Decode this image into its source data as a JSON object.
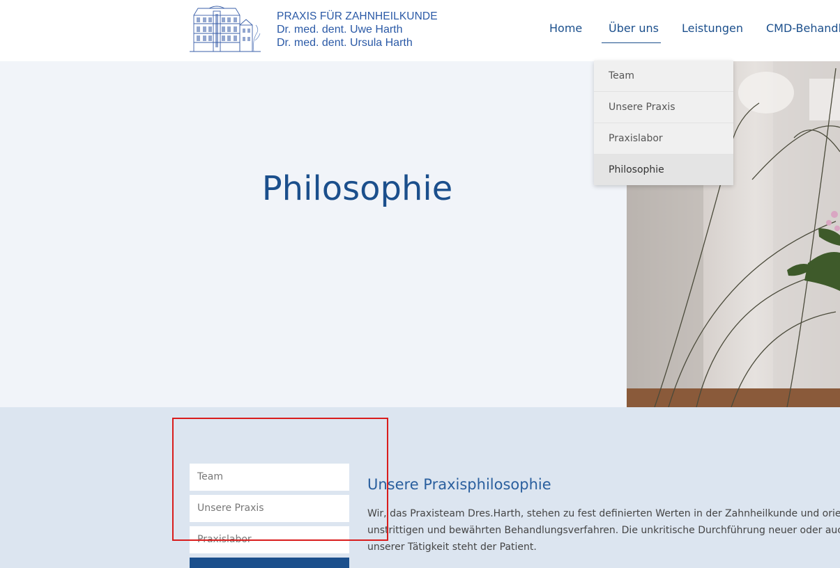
{
  "header": {
    "logo_line1": "PRAXIS FÜR ZAHNHEILKUNDE",
    "logo_line2": "Dr. med. dent. Uwe Harth",
    "logo_line3": "Dr. med. dent. Ursula Harth"
  },
  "nav": {
    "items": [
      {
        "label": "Home"
      },
      {
        "label": "Über uns"
      },
      {
        "label": "Leistungen"
      },
      {
        "label": "CMD-Behandl"
      }
    ],
    "active": "Über uns"
  },
  "dropdown": {
    "items": [
      {
        "label": "Team"
      },
      {
        "label": "Unsere Praxis"
      },
      {
        "label": "Praxislabor"
      },
      {
        "label": "Philosophie"
      }
    ],
    "active": "Philosophie"
  },
  "hero": {
    "title": "Philosophie"
  },
  "sidebar": {
    "items": [
      {
        "label": "Team"
      },
      {
        "label": "Unsere Praxis"
      },
      {
        "label": "Praxislabor"
      }
    ]
  },
  "content": {
    "heading": "Unsere Praxisphilosophie",
    "lines": [
      "Wir, das Praxisteam Dres.Harth, stehen zu fest definierten Werten in der Zahnheilkunde und orientieren",
      "unstrittigen und bewährten Behandlungsverfahren. Die unkritische Durchführung neuer oder auch fragw",
      "unserer Tätigkeit steht der Patient."
    ]
  },
  "colors": {
    "brand_blue": "#1b4f8c",
    "logo_blue": "#2a59a6",
    "hero_bg": "#f1f4f9",
    "lower_bg": "#dce5f0",
    "highlight_red": "#d91c1c"
  }
}
